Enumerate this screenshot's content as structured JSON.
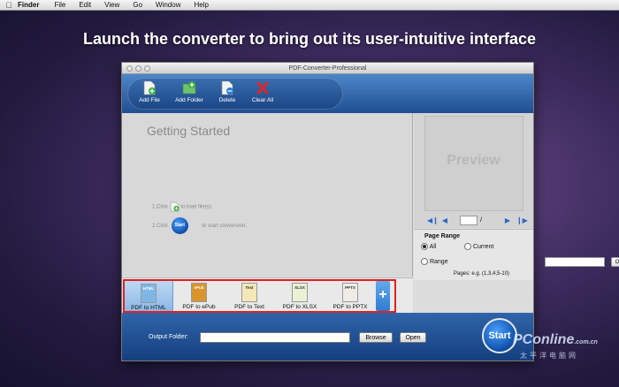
{
  "menubar": {
    "app": "Finder",
    "items": [
      "File",
      "Edit",
      "View",
      "Go",
      "Window",
      "Help"
    ]
  },
  "headline": "Launch the converter to bring out its user-intuitive interface",
  "window": {
    "title": "PDF-Converter-Professional"
  },
  "toolbar": {
    "add_file": "Add File",
    "add_folder": "Add Folder",
    "delete": "Delete",
    "clear_all": "Clear All"
  },
  "getting_started": {
    "title": "Getting Started",
    "step1_prefix": "1.Click",
    "step1_suffix": "to load file(s).",
    "step2_prefix": "2.Click",
    "step2_icon_label": "Start",
    "step2_suffix": "to start conversion."
  },
  "preview": {
    "label": "Preview",
    "page_separator": "/"
  },
  "page_range": {
    "title": "Page Range",
    "all": "All",
    "current": "Current",
    "range": "Range",
    "ok": "Ok",
    "hint": "Pages: e.g. (1,3,4,5-10)",
    "selected": "All"
  },
  "formats": [
    {
      "label": "PDF to HTML",
      "tag": "HTML",
      "selected": true
    },
    {
      "label": "PDF to ePub",
      "tag": "ePub",
      "selected": false
    },
    {
      "label": "PDF to Text",
      "tag": "Text",
      "selected": false
    },
    {
      "label": "PDF to XLSX",
      "tag": "XLSX",
      "selected": false
    },
    {
      "label": "PDF to PPTX",
      "tag": "PPTX",
      "selected": false
    }
  ],
  "plus_button": "+",
  "output": {
    "label": "Output Folder:",
    "value": "",
    "browse": "Browse",
    "open": "Open"
  },
  "start_button": "Start",
  "watermark": {
    "brand": "PConline",
    "suffix": ".com.cn",
    "chinese": "太平洋电脑网"
  },
  "colors": {
    "toolbar_blue": "#2b5fa3",
    "highlight_red": "#e02020",
    "nav_blue": "#2b67c9"
  }
}
